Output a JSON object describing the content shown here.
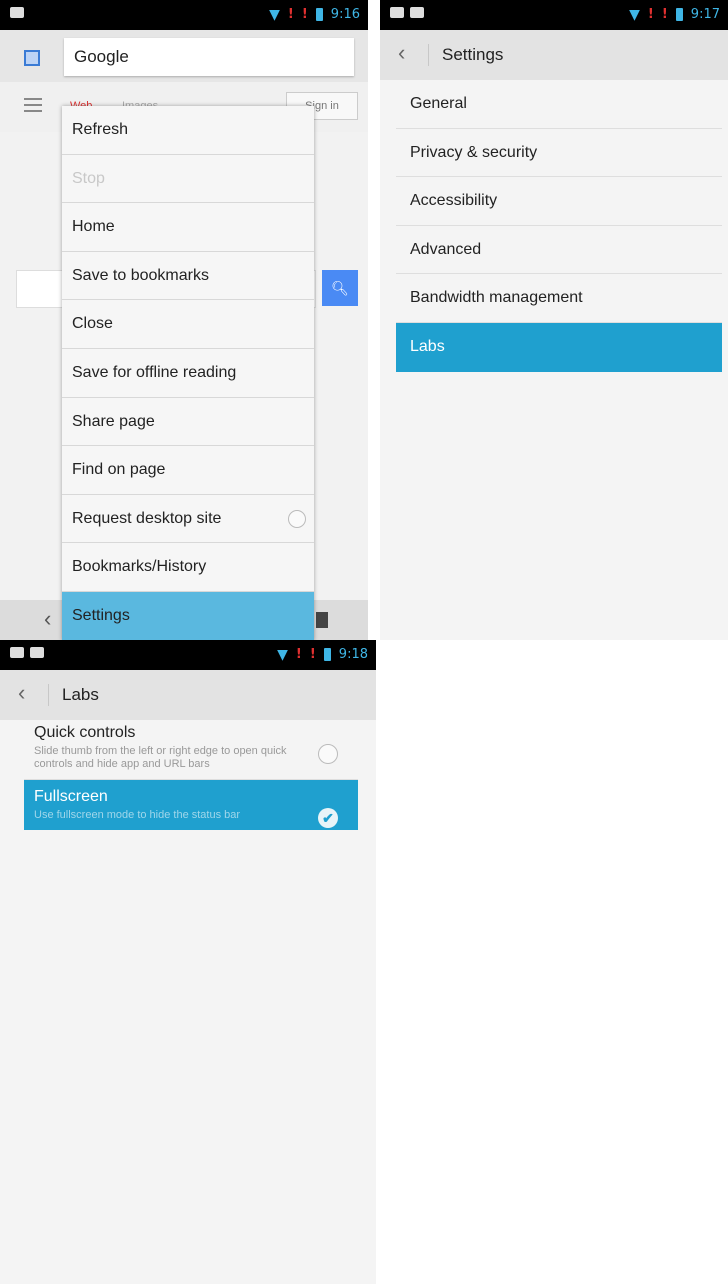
{
  "panel1": {
    "status_time": "9:16",
    "url_text": "Google",
    "google_bar": {
      "tab_web": "Web",
      "tab_images": "Images",
      "sign_in": "Sign in"
    },
    "menu": [
      {
        "label": "Refresh",
        "enabled": true
      },
      {
        "label": "Stop",
        "enabled": false
      },
      {
        "label": "Home",
        "enabled": true
      },
      {
        "label": "Save to bookmarks",
        "enabled": true
      },
      {
        "label": "Close",
        "enabled": true
      },
      {
        "label": "Save for offline reading",
        "enabled": true
      },
      {
        "label": "Share page",
        "enabled": true
      },
      {
        "label": "Find on page",
        "enabled": true
      },
      {
        "label": "Request desktop site",
        "enabled": true,
        "checked": false
      },
      {
        "label": "Bookmarks/History",
        "enabled": true
      },
      {
        "label": "Settings",
        "enabled": true,
        "selected": true
      }
    ]
  },
  "panel2": {
    "status_time": "9:17",
    "title": "Settings",
    "items": [
      "General",
      "Privacy & security",
      "Accessibility",
      "Advanced",
      "Bandwidth management",
      "Labs"
    ],
    "selected_item": "Labs"
  },
  "panel3": {
    "status_time": "9:18",
    "title": "Labs",
    "items": [
      {
        "title": "Quick controls",
        "description": "Slide thumb from the left or right edge to open quick controls and hide app and URL bars",
        "checked": false
      },
      {
        "title": "Fullscreen",
        "description": "Use fullscreen mode to hide the status bar",
        "checked": true
      }
    ]
  },
  "colors": {
    "accent": "#1fa0cf",
    "menu_selected": "#5ab8df",
    "status_icon": "#3fb6e6"
  }
}
